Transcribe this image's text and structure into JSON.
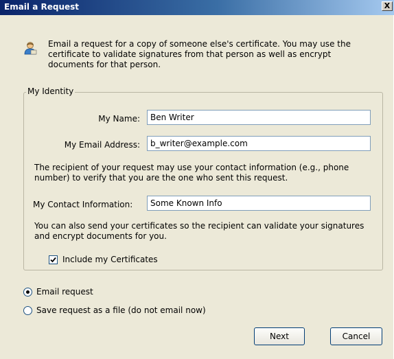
{
  "window": {
    "title": "Email a Request",
    "close_label": "X"
  },
  "intro": {
    "text": "Email a request for a copy of someone else's certificate. You may use the certificate to validate signatures from that person as well as encrypt documents for that person."
  },
  "identity": {
    "legend": "My Identity",
    "name_label": "My Name:",
    "name_value": "Ben Writer",
    "email_label": "My Email Address:",
    "email_value": "b_writer@example.com",
    "contact_note": "The recipient of your request may use your contact information (e.g., phone number) to verify that you are the one who sent this request.",
    "contact_label": "My Contact Information:",
    "contact_value": "Some Known Info",
    "cert_note": "You can also send your certificates so the recipient can validate your signatures and encrypt documents for you.",
    "include_certs_label": "Include my Certificates",
    "include_certs_checked": true
  },
  "delivery": {
    "email_label": "Email request",
    "save_label": "Save request as a file (do not email now)",
    "selected": "email"
  },
  "buttons": {
    "next": "Next",
    "cancel": "Cancel"
  }
}
